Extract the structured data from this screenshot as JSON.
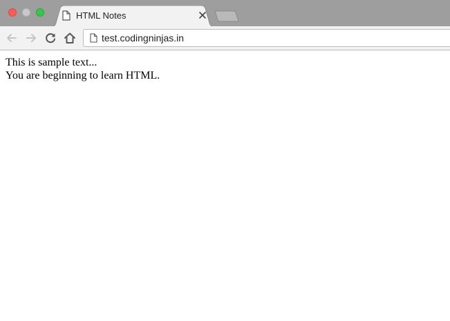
{
  "window_controls": {
    "close": "close",
    "minimize": "minimize",
    "maximize": "maximize"
  },
  "tab": {
    "title": "HTML Notes",
    "icon": "page-icon",
    "close_icon": "close-icon"
  },
  "new_tab_icon": "new-tab-icon",
  "toolbar": {
    "back_icon": "back-arrow-icon",
    "forward_icon": "forward-arrow-icon",
    "reload_icon": "reload-icon",
    "home_icon": "home-icon"
  },
  "address_bar": {
    "url": "test.codingninjas.in",
    "icon": "page-icon"
  },
  "page": {
    "line1": "This is sample text...",
    "line2": "You are beginning to learn HTML."
  },
  "colors": {
    "tabstrip": "#9e9e9e",
    "toolbar": "#f2f2f2",
    "close": "#fc5b57",
    "minimize": "#c9c9c9",
    "maximize": "#34c84a"
  }
}
